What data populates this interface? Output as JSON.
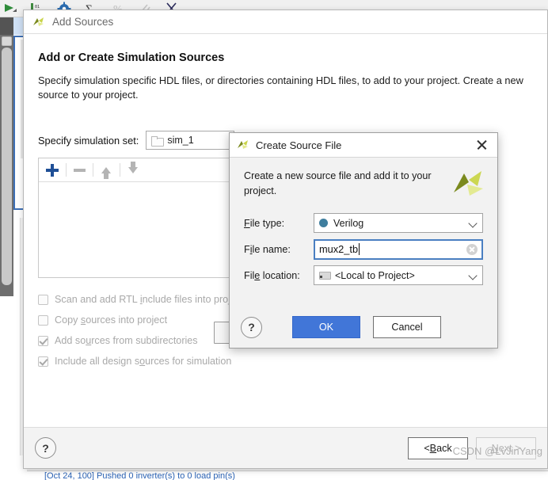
{
  "ide": {
    "toolbar_icons": [
      "run-icon",
      "binary-icon",
      "gear-icon",
      "sigma-icon",
      "percent-icon",
      "attach-icon",
      "cut-icon"
    ],
    "status_text": "[Oct 24, 100] Pushed 0 inverter(s) to 0 load pin(s)"
  },
  "outer_dialog": {
    "title": "Add Sources",
    "heading": "Add or Create Simulation Sources",
    "description": "Specify simulation specific HDL files, or directories containing HDL files, to add to your project. Create a new source to your project.",
    "simset_label": "Specify simulation set:",
    "simset_value": "sim_1",
    "filebox_tools": [
      {
        "name": "add-files-button",
        "icon": "plus-icon"
      },
      {
        "name": "remove-files-button",
        "icon": "minus-icon"
      },
      {
        "name": "move-up-button",
        "icon": "arrow-up-icon"
      },
      {
        "name": "move-down-button",
        "icon": "arrow-down-icon"
      }
    ],
    "checkboxes": [
      {
        "label_pre": "Scan and add RTL ",
        "label_u": "i",
        "label_post": "nclude files into project",
        "checked": false,
        "name": "scan-rtl-include-checkbox"
      },
      {
        "label_pre": "Copy ",
        "label_u": "s",
        "label_post": "ources into project",
        "checked": false,
        "name": "copy-sources-checkbox"
      },
      {
        "label_pre": "Add so",
        "label_u": "u",
        "label_post": "rces from subdirectories",
        "checked": true,
        "name": "add-subdirectories-checkbox"
      },
      {
        "label_pre": "Include all design s",
        "label_u": "o",
        "label_post": "urces for simulation",
        "checked": true,
        "name": "include-design-sources-checkbox"
      }
    ],
    "help_label": "?",
    "back_pre": "< ",
    "back_u": "B",
    "back_post": "ack",
    "next_pre": "",
    "next_u": "N",
    "next_post": "ext >"
  },
  "inner_dialog": {
    "title": "Create Source File",
    "intro": "Create a new source file and add it to your project.",
    "rows": {
      "file_type": {
        "label_pre": "",
        "label_u": "F",
        "label_post": "ile type:",
        "value": "Verilog"
      },
      "file_name": {
        "label_pre": "F",
        "label_u": "i",
        "label_post": "le name:",
        "value": "mux2_tb",
        "placeholder": ""
      },
      "file_location": {
        "label_pre": "Fil",
        "label_u": "e",
        "label_post": " location:",
        "value": "<Local to Project>"
      }
    },
    "help_label": "?",
    "ok_label": "OK",
    "cancel_label": "Cancel"
  },
  "watermark": "CSDN @LvJinYang",
  "colors": {
    "accent_blue": "#4176d8",
    "focus_border": "#4a7fc1",
    "verilog_dot": "#3f7e9e",
    "plus_blue": "#1f4f96",
    "status_blue": "#2b63b5"
  }
}
